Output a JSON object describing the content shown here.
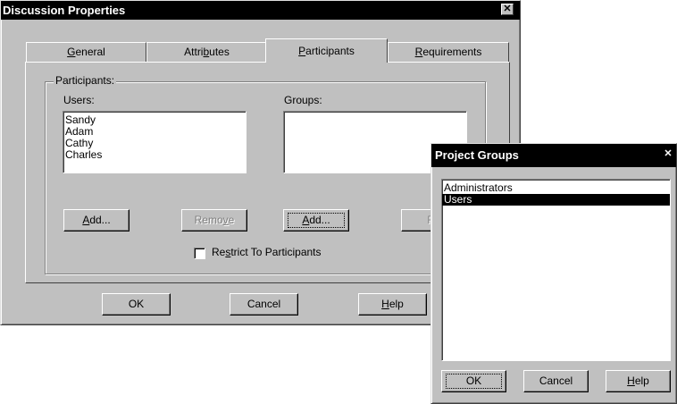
{
  "discussion_properties": {
    "title": "Discussion Properties",
    "close_glyph": "✕",
    "tabs": [
      {
        "label_pre": "",
        "label_ul": "G",
        "label_post": "eneral"
      },
      {
        "label_pre": "Attri",
        "label_ul": "b",
        "label_post": "utes"
      },
      {
        "label_pre": "",
        "label_ul": "P",
        "label_post": "articipants"
      },
      {
        "label_pre": "",
        "label_ul": "R",
        "label_post": "equirements"
      }
    ],
    "active_tab": "Participants",
    "group_label": "Participants:",
    "users_label": "Users:",
    "groups_label": "Groups:",
    "users": [
      "Sandy",
      "Adam",
      "Cathy",
      "Charles"
    ],
    "groups": [],
    "users_add": {
      "pre": "",
      "ul": "A",
      "post": "dd..."
    },
    "users_remove": {
      "pre": "Remo",
      "ul": "v",
      "post": "e"
    },
    "groups_add": {
      "pre": "",
      "ul": "A",
      "post": "dd..."
    },
    "groups_remove_partial": "Re",
    "restrict": {
      "pre": "Re",
      "ul": "s",
      "post": "trict To Participants",
      "checked": false
    },
    "ok": "OK",
    "cancel": "Cancel",
    "help": {
      "pre": "",
      "ul": "H",
      "post": "elp"
    }
  },
  "project_groups": {
    "title": "Project Groups",
    "close_glyph": "✕",
    "items": [
      "Administrators",
      "Users"
    ],
    "selected": "Users",
    "ok": "OK",
    "cancel": "Cancel",
    "help": {
      "pre": "",
      "ul": "H",
      "post": "elp"
    }
  }
}
